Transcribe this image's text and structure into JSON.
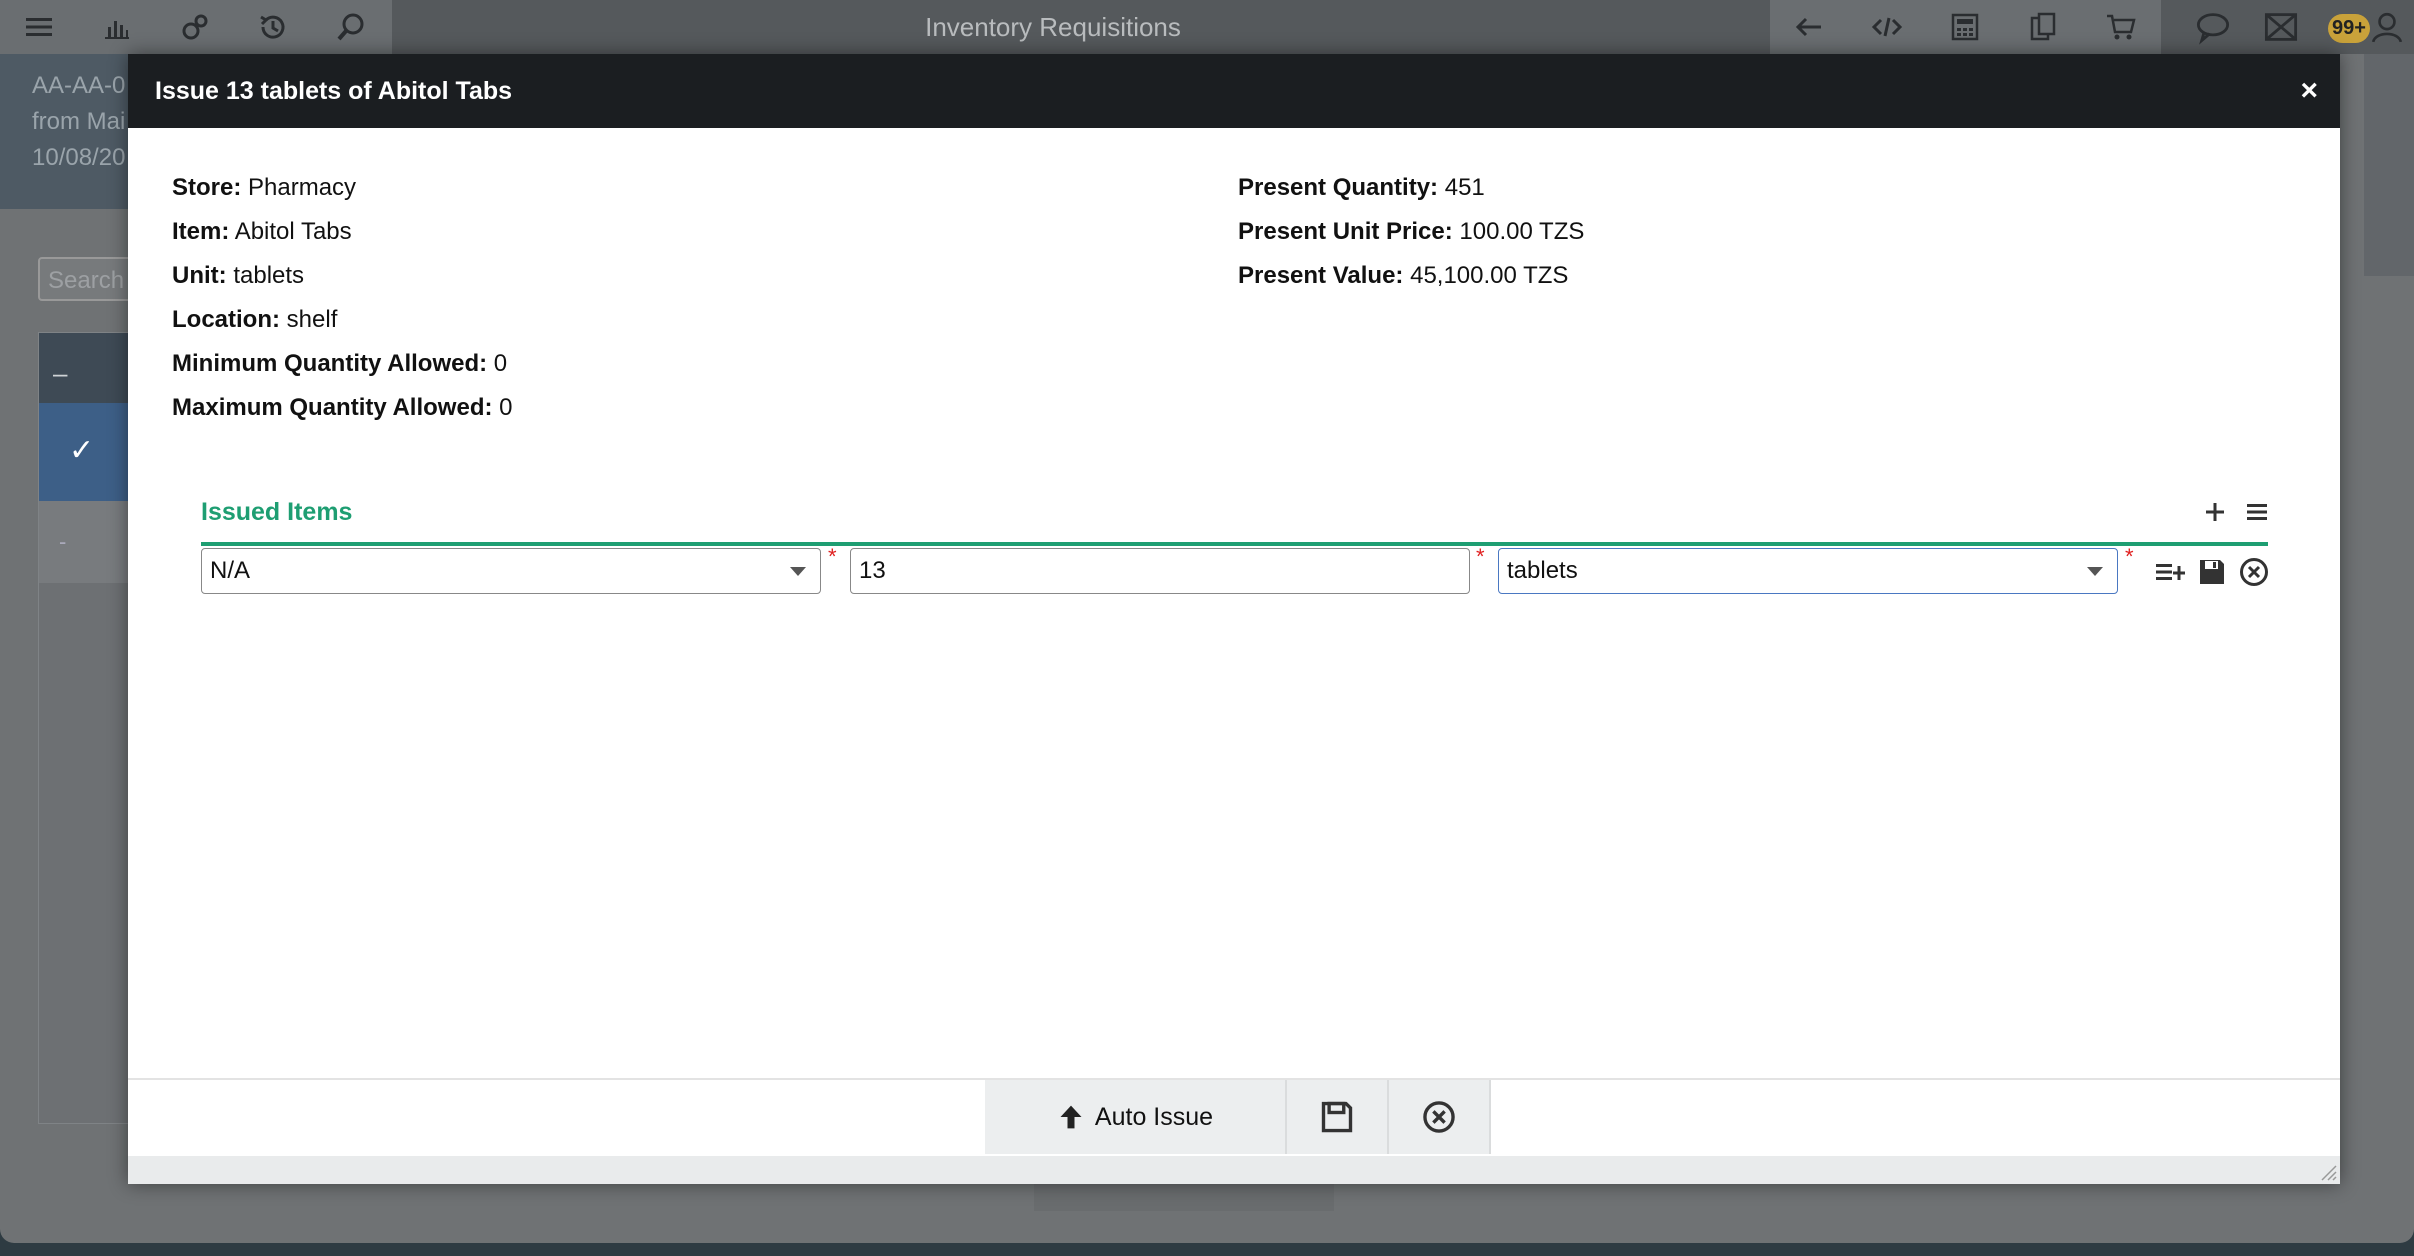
{
  "app": {
    "title": "Inventory Requisitions",
    "notification_count": "99+"
  },
  "background": {
    "panel_lines": [
      "AA-AA-0",
      "from Mai",
      "10/08/20"
    ],
    "search_placeholder": "Search",
    "list_header": "–",
    "list_row2": "-"
  },
  "modal": {
    "title": "Issue 13 tablets of Abitol Tabs",
    "close_label": "×",
    "left_info": [
      {
        "label": "Store:",
        "value": "Pharmacy"
      },
      {
        "label": "Item:",
        "value": "Abitol Tabs"
      },
      {
        "label": "Unit:",
        "value": "tablets"
      },
      {
        "label": "Location:",
        "value": "shelf"
      },
      {
        "label": "Minimum Quantity Allowed:",
        "value": "0"
      },
      {
        "label": "Maximum Quantity Allowed:",
        "value": "0"
      }
    ],
    "right_info": [
      {
        "label": "Present Quantity:",
        "value": "451"
      },
      {
        "label": "Present Unit Price:",
        "value": "100.00 TZS"
      },
      {
        "label": "Present Value:",
        "value": "45,100.00 TZS"
      }
    ],
    "issued_items": {
      "title": "Issued Items",
      "row": {
        "batch": "N/A",
        "quantity": "13",
        "unit": "tablets",
        "required_mark": "*"
      }
    },
    "footer": {
      "auto_issue_label": "Auto Issue"
    }
  }
}
